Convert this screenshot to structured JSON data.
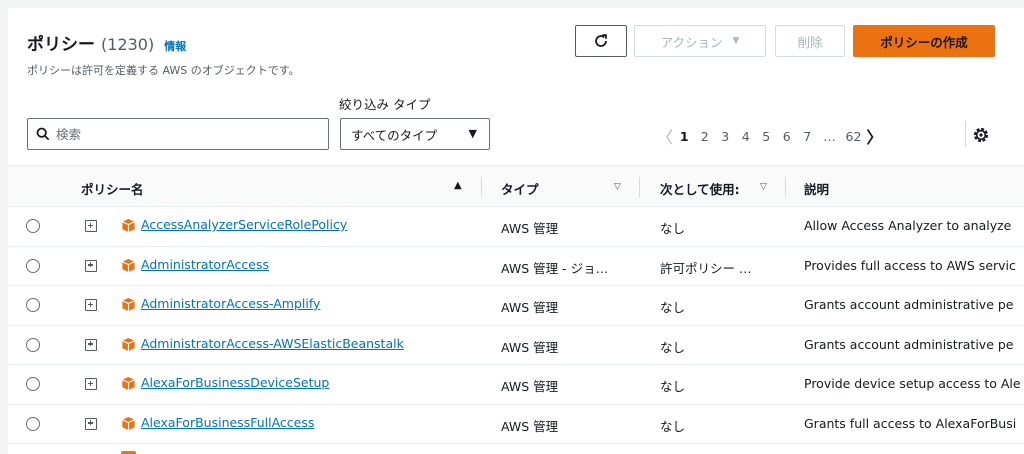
{
  "header": {
    "title": "ポリシー",
    "count": "(1230)",
    "info_link": "情報",
    "description": "ポリシーは許可を定義する AWS のオブジェクトです。"
  },
  "toolbar": {
    "refresh_icon": "refresh-icon",
    "actions_label": "アクション",
    "delete_label": "削除",
    "create_label": "ポリシーの作成",
    "accent_color": "#ec7211"
  },
  "filters": {
    "type_label": "絞り込み タイプ",
    "search_placeholder": "検索",
    "type_selected": "すべてのタイプ"
  },
  "pagination": {
    "pages": [
      "1",
      "2",
      "3",
      "4",
      "5",
      "6",
      "7"
    ],
    "current": "1",
    "ellipsis": "…",
    "last": "62",
    "prev_disabled": true
  },
  "table": {
    "columns": {
      "name": "ポリシー名",
      "type": "タイプ",
      "used_as": "次として使用:",
      "description": "説明"
    },
    "rows": [
      {
        "name": "AccessAnalyzerServiceRolePolicy",
        "type": "AWS 管理",
        "used_as": "なし",
        "description": "Allow Access Analyzer to analyze"
      },
      {
        "name": "AdministratorAccess",
        "type": "AWS 管理 - ジョ…",
        "used_as": "許可ポリシー …",
        "description": "Provides full access to AWS servic"
      },
      {
        "name": "AdministratorAccess-Amplify",
        "type": "AWS 管理",
        "used_as": "なし",
        "description": "Grants account administrative pe"
      },
      {
        "name": "AdministratorAccess-AWSElasticBeanstalk",
        "type": "AWS 管理",
        "used_as": "なし",
        "description": "Grants account administrative pe"
      },
      {
        "name": "AlexaForBusinessDeviceSetup",
        "type": "AWS 管理",
        "used_as": "なし",
        "description": "Provide device setup access to Ale"
      },
      {
        "name": "AlexaForBusinessFullAccess",
        "type": "AWS 管理",
        "used_as": "なし",
        "description": "Grants full access to AlexaForBusi"
      }
    ]
  }
}
